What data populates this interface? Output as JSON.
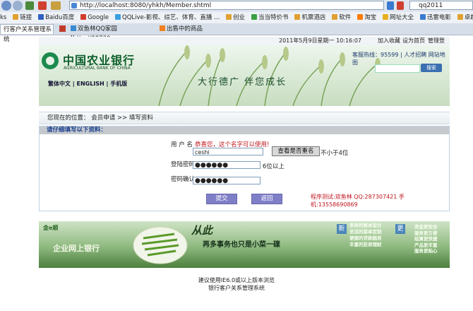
{
  "browser": {
    "url": "http://localhost:8080/yhkh/Member.shtml",
    "search_text": "qq2011",
    "favorites": [
      "ks",
      "链接",
      "Baidu百度",
      "Google",
      "QQLive-影视、综艺、体育、直播 ...",
      "创业",
      "当当特价书",
      "机票酒店",
      "软件",
      "淘宝",
      "网址大全",
      "迅雷电影",
      "卓越商城"
    ],
    "tabs": [
      "行客户关系管理系统",
      "双鱼林QQ家园 [http://28730...",
      "出售中的商品"
    ]
  },
  "topinfo": {
    "datetime": "2011年5月9日星期一  10:16:07",
    "weekday": "星期一",
    "links": [
      "加入收藏",
      "设为首页",
      "管理登陆"
    ]
  },
  "banner": {
    "bank_name_cn": "中国农业银行",
    "bank_name_en": "AGRICULTURAL BANK OF CHINA",
    "lang_links": "繁体中文 | ENGLISH | 手机版",
    "slogan": "大行德广  伴您成长",
    "hotline": "客服热线：95599 | 人才招聘   网站地图",
    "search_btn": "搜索"
  },
  "breadcrumb": "您现在的位置： 会员申请 >> 填写资料",
  "form": {
    "heading": "请仔细填写以下资料：",
    "username_label": "用 户 名",
    "username_notice": "恭喜您，这个名字可以使用!",
    "username_value": "ceshi",
    "check_button": "查看是否重名",
    "username_hint": "不小于4位",
    "password_label": "登陆密码",
    "password_value": "●●●●●●",
    "password_hint": "6位以上",
    "confirm_label": "密码确认",
    "confirm_value": "●●●●●●",
    "submit_button": "提交",
    "back_button": "返回",
    "contact": "程序测试:双鱼林 QQ:287307421  手机:13558690869"
  },
  "ad": {
    "brand": "金e顺",
    "left_text": "企业网上银行",
    "title": "从此",
    "subtitle": "再多事务也只是小菜一碟",
    "badge_new": "新",
    "badge_more": "更",
    "features_mid": [
      "多样的账本设计",
      "灵活的菜单定制",
      "便捷的贷款融资",
      "丰富的投资理财"
    ],
    "features_right": [
      "资金更安全",
      "服务更方便",
      "结算更快捷",
      "产品更丰富",
      "服务更贴心"
    ]
  },
  "footer": {
    "line1": "建议使用IE6.0或以上版本浏览",
    "line2": "银行客户关系管理系统"
  },
  "colors": {
    "accent": "#1c8a4c",
    "heading": "#1a3f8f",
    "notice": "#c0141c",
    "button": "#7f7fc8"
  }
}
